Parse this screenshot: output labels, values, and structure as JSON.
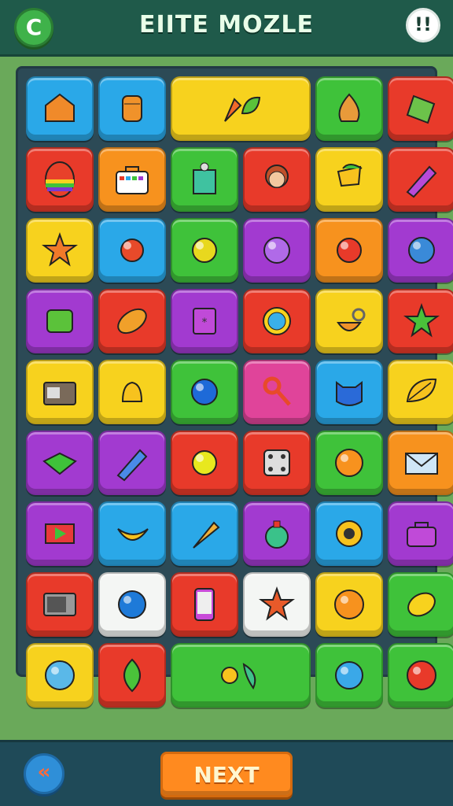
{
  "header": {
    "title": "EIITE MOZLE",
    "refresh_icon_glyph": "C",
    "info_icon_glyph": "!!"
  },
  "footer": {
    "back_icon_glyph": "«",
    "next_label": "NEXT"
  },
  "colors": {
    "blue": "#2aa8e8",
    "yellow": "#f7d21e",
    "green": "#3fc23a",
    "red": "#e83a2a",
    "orange": "#f7921e",
    "purple": "#a23ad0",
    "pink": "#e0449a",
    "white": "#f4f6f4"
  },
  "grid": {
    "rows": [
      [
        {
          "color": "blue",
          "icon": "orange-house-icon",
          "span": 1
        },
        {
          "color": "blue",
          "icon": "orange-jar-icon",
          "span": 1
        },
        {
          "color": "yellow",
          "icon": "carrot-and-leaf-icon",
          "span": 2
        },
        {
          "color": "green",
          "icon": "onion-icon",
          "span": 1
        },
        {
          "color": "red",
          "icon": "green-tag-icon",
          "span": 1
        }
      ],
      [
        {
          "color": "red",
          "icon": "rainbow-egg-icon",
          "span": 1
        },
        {
          "color": "orange",
          "icon": "briefcase-icon",
          "span": 1
        },
        {
          "color": "green",
          "icon": "robot-icon",
          "span": 1
        },
        {
          "color": "red",
          "icon": "girl-avatar-icon",
          "span": 1
        },
        {
          "color": "yellow",
          "icon": "lamp-icon",
          "span": 1
        },
        {
          "color": "red",
          "icon": "purple-crayon-icon",
          "span": 1
        }
      ],
      [
        {
          "color": "yellow",
          "icon": "sun-face-icon",
          "span": 1
        },
        {
          "color": "blue",
          "icon": "red-creature-icon",
          "span": 1
        },
        {
          "color": "green",
          "icon": "lemon-icon",
          "span": 1
        },
        {
          "color": "purple",
          "icon": "bubble-icon",
          "span": 1
        },
        {
          "color": "orange",
          "icon": "red-ball-icon",
          "span": 1
        },
        {
          "color": "purple",
          "icon": "blue-ball-icon",
          "span": 1
        }
      ],
      [
        {
          "color": "purple",
          "icon": "green-bag-icon",
          "span": 1
        },
        {
          "color": "red",
          "icon": "football-icon",
          "span": 1
        },
        {
          "color": "purple",
          "icon": "star-card-icon",
          "span": 1
        },
        {
          "color": "red",
          "icon": "snowflake-medal-icon",
          "span": 1
        },
        {
          "color": "yellow",
          "icon": "acorn-icon",
          "span": 1
        },
        {
          "color": "red",
          "icon": "green-star-icon",
          "span": 1
        }
      ],
      [
        {
          "color": "yellow",
          "icon": "camera-icon",
          "span": 1
        },
        {
          "color": "yellow",
          "icon": "bell-icon",
          "span": 1
        },
        {
          "color": "green",
          "icon": "blue-orb-icon",
          "span": 1
        },
        {
          "color": "pink",
          "icon": "key-icon",
          "span": 1
        },
        {
          "color": "blue",
          "icon": "cat-head-icon",
          "span": 1
        },
        {
          "color": "yellow",
          "icon": "leaf-pin-icon",
          "span": 1
        }
      ],
      [
        {
          "color": "purple",
          "icon": "green-envelope-icon",
          "span": 1
        },
        {
          "color": "purple",
          "icon": "crayon-icon",
          "span": 1
        },
        {
          "color": "red",
          "icon": "yellow-button-icon",
          "span": 1
        },
        {
          "color": "red",
          "icon": "dice-icon",
          "span": 1
        },
        {
          "color": "green",
          "icon": "orange-fruit-icon",
          "span": 1
        },
        {
          "color": "orange",
          "icon": "envelope-icon",
          "span": 1
        }
      ],
      [
        {
          "color": "purple",
          "icon": "flag-icon",
          "span": 1
        },
        {
          "color": "blue",
          "icon": "banana-icon",
          "span": 1
        },
        {
          "color": "blue",
          "icon": "ice-cream-icon",
          "span": 1
        },
        {
          "color": "purple",
          "icon": "potion-icon",
          "span": 1
        },
        {
          "color": "blue",
          "icon": "target-icon",
          "span": 1
        },
        {
          "color": "purple",
          "icon": "purse-icon",
          "span": 1
        }
      ],
      [
        {
          "color": "red",
          "icon": "microwave-icon",
          "span": 1
        },
        {
          "color": "white",
          "icon": "blue-bubble-icon",
          "span": 1
        },
        {
          "color": "red",
          "icon": "phone-icon",
          "span": 1
        },
        {
          "color": "white",
          "icon": "eye-star-icon",
          "span": 1
        },
        {
          "color": "yellow",
          "icon": "orange-coin-icon",
          "span": 1
        },
        {
          "color": "green",
          "icon": "yellow-lemon-icon",
          "span": 1
        }
      ],
      [
        {
          "color": "yellow",
          "icon": "speech-bubble-icon",
          "span": 1
        },
        {
          "color": "red",
          "icon": "green-leaf-icon",
          "span": 1
        },
        {
          "color": "green",
          "icon": "sun-and-kite-icon",
          "span": 2
        },
        {
          "color": "green",
          "icon": "glass-orb-icon",
          "span": 1
        },
        {
          "color": "green",
          "icon": "red-apple-icon",
          "span": 1
        }
      ]
    ]
  }
}
